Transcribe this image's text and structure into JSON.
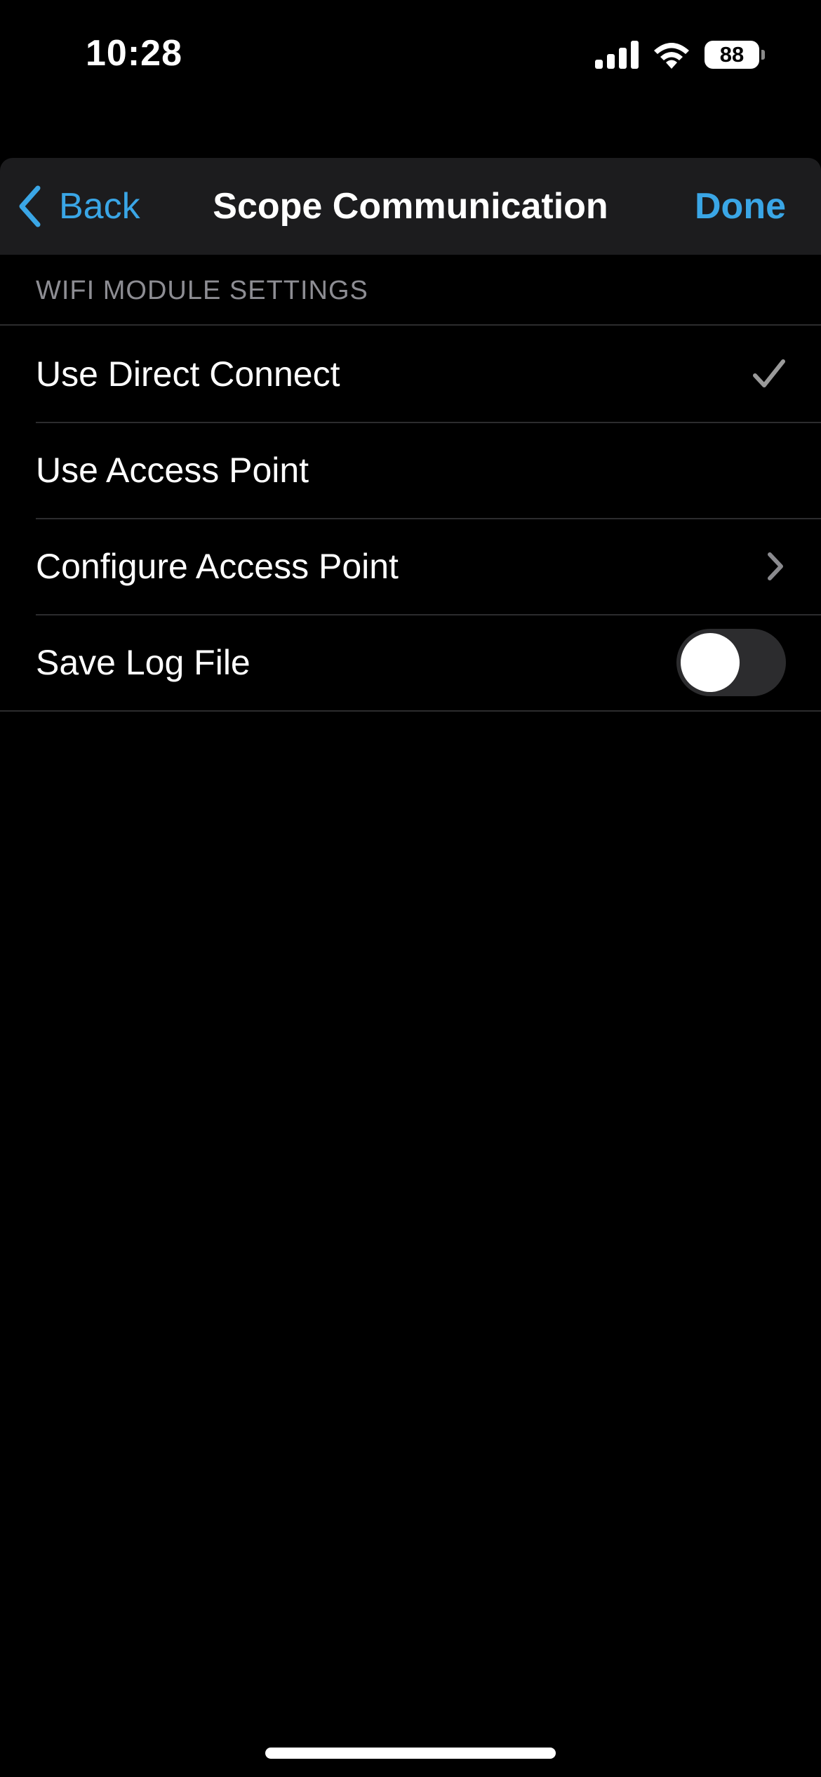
{
  "status_bar": {
    "time": "10:28",
    "battery_level": "88",
    "icons": [
      "signal-icon",
      "wifi-icon",
      "battery-icon"
    ]
  },
  "nav": {
    "back_label": "Back",
    "title": "Scope Communication",
    "done_label": "Done",
    "accent_color": "#3aa6e6"
  },
  "section": {
    "header": "WIFI MODULE SETTINGS",
    "rows": [
      {
        "label": "Use Direct Connect",
        "accessory": "checkmark-icon",
        "selected": true
      },
      {
        "label": "Use Access Point",
        "accessory": "none",
        "selected": false
      },
      {
        "label": "Configure Access Point",
        "accessory": "chevron-right-icon"
      },
      {
        "label": "Save Log File",
        "accessory": "toggle",
        "toggle_on": false
      }
    ]
  },
  "colors": {
    "background": "#000000",
    "nav_background": "#1c1c1e",
    "separator": "#2c2c2e",
    "secondary_text": "#8d8d93"
  }
}
